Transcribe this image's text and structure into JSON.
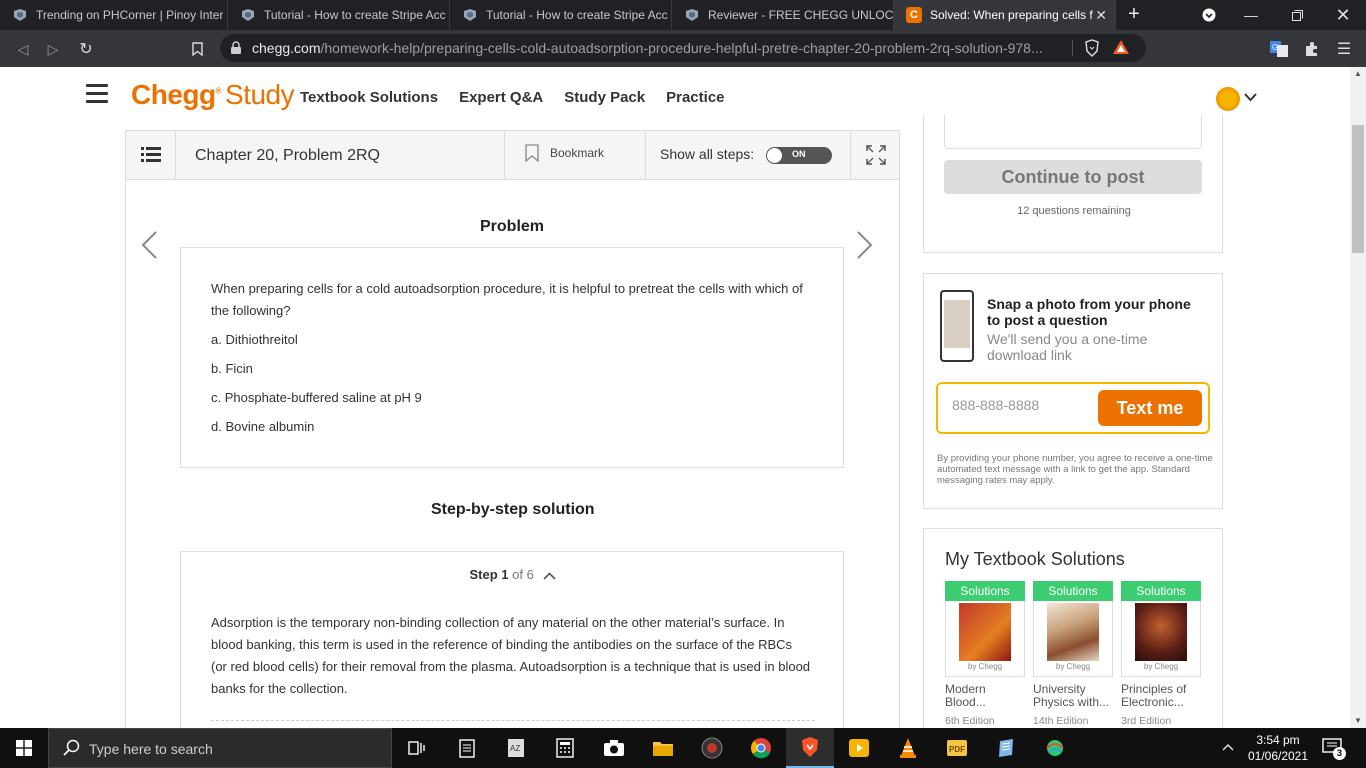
{
  "browser": {
    "tabs": [
      {
        "title": "Trending on PHCorner | Pinoy Inter",
        "active": false
      },
      {
        "title": "Tutorial - How to create Stripe Acc",
        "active": false
      },
      {
        "title": "Tutorial - How to create Stripe Acc",
        "active": false
      },
      {
        "title": "Reviewer - FREE CHEGG UNLOCKS",
        "active": false
      },
      {
        "title": "Solved: When preparing cells f",
        "active": true
      }
    ],
    "url_domain": "chegg.com",
    "url_path": "/homework-help/preparing-cells-cold-autoadsorption-procedure-helpful-pretre-chapter-20-problem-2rq-solution-978..."
  },
  "header": {
    "logo_primary": "Chegg",
    "logo_secondary": "Study",
    "nav": [
      "Textbook Solutions",
      "Expert Q&A",
      "Study Pack",
      "Practice"
    ]
  },
  "toolbar": {
    "chapter": "Chapter 20, Problem 2RQ",
    "bookmark_label": "Bookmark",
    "show_steps_label": "Show all steps:",
    "toggle_label": "ON"
  },
  "problem": {
    "heading": "Problem",
    "question": "When preparing cells for a cold autoadsorption procedure, it is helpful to pretreat the cells with which of the following?",
    "options": [
      "a. Dithiothreitol",
      "b. Ficin",
      "c. Phosphate-buffered saline at pH 9",
      "d. Bovine albumin"
    ]
  },
  "solution": {
    "heading": "Step-by-step solution",
    "step_label": "Step 1",
    "step_of": "of 6",
    "step_text": "Adsorption is the temporary non-binding collection of any material on the other material’s surface. In blood banking, this term is used in the reference of binding the antibodies on the surface of the RBCs (or red blood cells) for their removal from the plasma. Autoadsorption is a technique that is used in blood banks for the collection."
  },
  "post": {
    "continue_label": "Continue to post",
    "remaining": "12 questions remaining"
  },
  "snap": {
    "title": "Snap a photo from your phone to post a question",
    "subtitle": "We'll send you a one-time download link",
    "phone_placeholder": "888-888-8888",
    "button_label": "Text me",
    "disclaimer": "By providing your phone number, you agree to receive a one-time automated text message with a link to get the app. Standard messaging rates may apply."
  },
  "textbooks": {
    "title": "My Textbook Solutions",
    "badge": "Solutions",
    "by": "by Chegg",
    "books": [
      {
        "title": "Modern Blood...",
        "edition": "6th Edition",
        "color": "#c0392b"
      },
      {
        "title": "University Physics with...",
        "edition": "14th Edition",
        "color": "#8e6b4e"
      },
      {
        "title": "Principles of Electronic...",
        "edition": "3rd Edition",
        "color": "#6b2a1e"
      }
    ]
  },
  "taskbar": {
    "search_placeholder": "Type here to search",
    "time": "3:54 pm",
    "date": "01/06/2021",
    "notification_count": "3"
  }
}
